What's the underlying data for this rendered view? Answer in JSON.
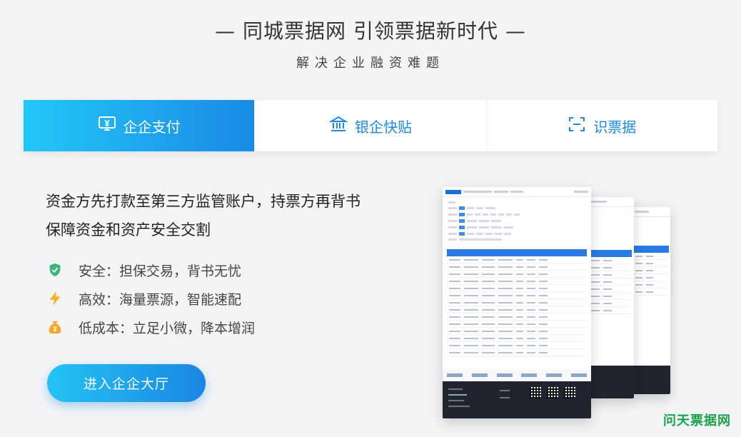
{
  "header": {
    "title": "— 同城票据网 引领票据新时代 —",
    "subtitle": "解决企业融资难题"
  },
  "tabs": [
    {
      "label": "企企支付",
      "icon": "yuan-monitor-icon",
      "active": true
    },
    {
      "label": "银企快贴",
      "icon": "bank-icon",
      "active": false
    },
    {
      "label": "识票据",
      "icon": "scan-icon",
      "active": false
    }
  ],
  "content": {
    "description_line1": "资金方先打款至第三方监管账户，持票方再背书",
    "description_line2": "保障资金和资产安全交割",
    "features": [
      {
        "icon": "shield-check-icon",
        "text": "安全：担保交易，背书无忧",
        "color": "#3cb878"
      },
      {
        "icon": "lightning-icon",
        "text": "高效：海量票源，智能速配",
        "color": "#f5b21b"
      },
      {
        "icon": "money-bag-icon",
        "text": "低成本：立足小微，降本增润",
        "color": "#f5a623"
      }
    ],
    "cta_label": "进入企企大厅"
  },
  "watermark": "问天票据网",
  "colors": {
    "accent_start": "#22c7f7",
    "accent_end": "#1a8ae6",
    "tab_text": "#1e88e5",
    "watermark": "#1aa34a"
  }
}
